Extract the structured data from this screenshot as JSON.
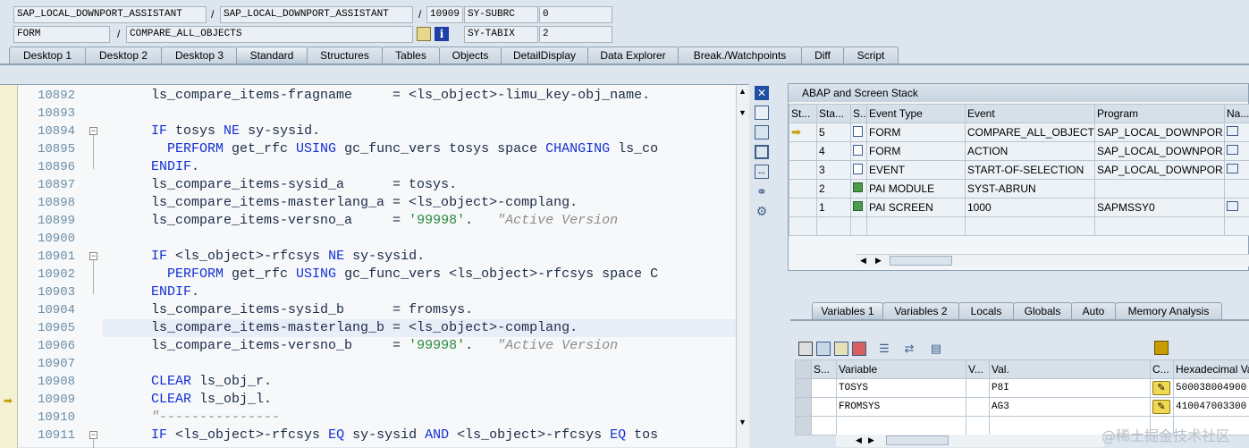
{
  "header": {
    "row1": {
      "program": "SAP_LOCAL_DOWNPORT_ASSISTANT",
      "include": "SAP_LOCAL_DOWNPORT_ASSISTANT",
      "line": "10909",
      "sysvar_name": "SY-SUBRC",
      "sysvar_value": "0"
    },
    "row2": {
      "event_type": "FORM",
      "event": "COMPARE_ALL_OBJECTS",
      "sysvar_name": "SY-TABIX",
      "sysvar_value": "2"
    },
    "slash": "/"
  },
  "tabs": [
    "Desktop 1",
    "Desktop 2",
    "Desktop 3",
    "Standard",
    "Structures",
    "Tables",
    "Objects",
    "DetailDisplay",
    "Data Explorer",
    "Break./Watchpoints",
    "Diff",
    "Script"
  ],
  "code": {
    "lines": [
      {
        "n": "10892",
        "t": "  ls_compare_items-fragname     = <ls_object>-limu_key-obj_name."
      },
      {
        "n": "10893",
        "t": ""
      },
      {
        "n": "10894",
        "t": "  IF tosys NE sy-sysid."
      },
      {
        "n": "10895",
        "t": "    PERFORM get_rfc USING gc_func_vers tosys space CHANGING ls_co"
      },
      {
        "n": "10896",
        "t": "  ENDIF."
      },
      {
        "n": "10897",
        "t": "  ls_compare_items-sysid_a      = tosys."
      },
      {
        "n": "10898",
        "t": "  ls_compare_items-masterlang_a = <ls_object>-complang."
      },
      {
        "n": "10899",
        "t": "  ls_compare_items-versno_a     = '99998'.   \"Active Version"
      },
      {
        "n": "10900",
        "t": ""
      },
      {
        "n": "10901",
        "t": "  IF <ls_object>-rfcsys NE sy-sysid."
      },
      {
        "n": "10902",
        "t": "    PERFORM get_rfc USING gc_func_vers <ls_object>-rfcsys space C"
      },
      {
        "n": "10903",
        "t": "  ENDIF."
      },
      {
        "n": "10904",
        "t": "  ls_compare_items-sysid_b      = fromsys."
      },
      {
        "n": "10905",
        "t": "  ls_compare_items-masterlang_b = <ls_object>-complang."
      },
      {
        "n": "10906",
        "t": "  ls_compare_items-versno_b     = '99998'.   \"Active Version"
      },
      {
        "n": "10907",
        "t": ""
      },
      {
        "n": "10908",
        "t": "  CLEAR ls_obj_r."
      },
      {
        "n": "10909",
        "t": "  CLEAR ls_obj_l."
      },
      {
        "n": "10910",
        "t": "  \"---------------"
      },
      {
        "n": "10911",
        "t": "  IF <ls_object>-rfcsys EQ sy-sysid AND <ls_object>-rfcsys EQ tos"
      }
    ]
  },
  "stack": {
    "title": "ABAP and Screen Stack",
    "columns": [
      "St...",
      "Sta...",
      "S...",
      "Event Type",
      "Event",
      "Program",
      "Na..."
    ],
    "rows": [
      {
        "level": "5",
        "type": "FORM",
        "event": "COMPARE_ALL_OBJECTS",
        "program": "SAP_LOCAL_DOWNPOR..."
      },
      {
        "level": "4",
        "type": "FORM",
        "event": "ACTION",
        "program": "SAP_LOCAL_DOWNPOR..."
      },
      {
        "level": "3",
        "type": "EVENT",
        "event": "START-OF-SELECTION",
        "program": "SAP_LOCAL_DOWNPOR..."
      },
      {
        "level": "2",
        "type": "PAI MODULE",
        "event": "SYST-ABRUN",
        "program": ""
      },
      {
        "level": "1",
        "type": "PAI SCREEN",
        "event": "1000",
        "program": "SAPMSSY0"
      }
    ]
  },
  "var_tabs": [
    "Variables 1",
    "Variables 2",
    "Locals",
    "Globals",
    "Auto",
    "Memory Analysis"
  ],
  "variables": {
    "columns": [
      "S...",
      "Variable",
      "V...",
      "Val.",
      "C...",
      "Hexadecimal Va"
    ],
    "rows": [
      {
        "name": "TOSYS",
        "value": "P8I",
        "hex": "500038004900"
      },
      {
        "name": "FROMSYS",
        "value": "AG3",
        "hex": "410047003300"
      }
    ]
  },
  "watermark": "@稀土掘金技术社区",
  "colors": {
    "keyword": "#1630d5",
    "string": "#2c8a3e",
    "comment": "#8c8c8c",
    "current_line": "#e8eef8"
  }
}
